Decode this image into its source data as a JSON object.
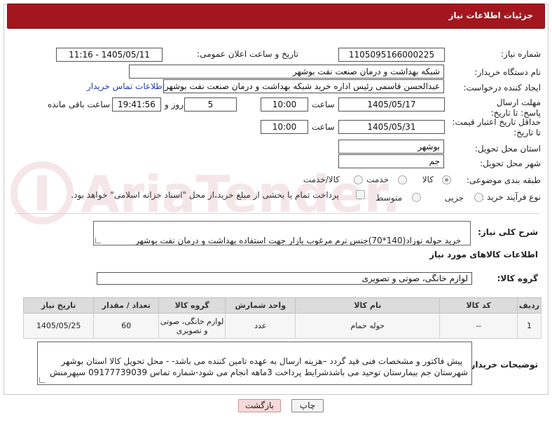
{
  "header": {
    "title": "جزئیات اطلاعات نیاز"
  },
  "fields": {
    "need_number_label": "شماره نیاز:",
    "need_number": "1105095166000225",
    "announce_label": "تاریخ و ساعت اعلان عمومی:",
    "announce_value": "1405/05/11 - 11:16",
    "buyer_org_label": "نام دستگاه خریدار:",
    "buyer_org": "شبکه بهداشت و درمان صنعت نفت بوشهر",
    "requester_label": "ایجاد کننده درخواست:",
    "requester": "عبدالحسن قاسمی رئیس اداره خرید  شبکه بهداشت و درمان صنعت نفت بوشهر",
    "buyer_contact_link": "اطلاعات تماس خریدار",
    "deadline_label": "مهلت ارسال پاسخ: تا تاریخ:",
    "deadline_date": "1405/05/17",
    "time_label": "ساعت",
    "deadline_time": "10:00",
    "days_value": "5",
    "days_label": "روز و",
    "remaining_time": "19:41:56",
    "remaining_label": "ساعت باقی مانده",
    "validity_label": "حداقل تاریخ اعتبار قیمت: تا تاریخ:",
    "validity_date": "1405/05/31",
    "validity_time_label": "ساعت",
    "validity_time": "10:00",
    "province_label": "استان محل تحویل:",
    "province": "بوشهر",
    "city_label": "شهر محل تحویل:",
    "city": "جم",
    "category_label": "طبقه بندی موضوعی:",
    "category_options": [
      "کالا",
      "خدمت",
      "کالا/خدمت"
    ],
    "process_label": "نوع فرآیند خرید :",
    "process_options": [
      "جزیی",
      "متوسط"
    ],
    "payment_note": "پرداخت تمام یا بخشی از مبلغ خرید،از محل \"اسناد خزانه اسلامی\" خواهد بود."
  },
  "description": {
    "label": "شرح کلی نیاز:",
    "text": "خرید حوله نوزاد(140*70)جنس نرم مرغوب بازار جهت استفاده بهداشت و درمان نفت بوشهر"
  },
  "goods_info": {
    "title": "اطلاعات کالاهای مورد نیاز"
  },
  "goods_group": {
    "label": "گروه کالا:",
    "value": "لوازم خانگی، صوتی و تصویری"
  },
  "table": {
    "headers": [
      "ردیف",
      "کد کالا",
      "نام کالا",
      "واحد شمارش",
      "گروه کالا",
      "تعداد / مقدار",
      "تاریخ نیاز"
    ],
    "rows": [
      [
        "1",
        "--",
        "حوله حمام",
        "عدد",
        "لوازم خانگی، صوتی و تصویری",
        "60",
        "1405/05/25"
      ]
    ]
  },
  "buyer_notes": {
    "label": "توضیحات خریدار:",
    "text": "پیش فاکتور و مشخصات فنی قید گردد –هزینه ارسال به عهده تامین کننده می باشد- - محل تحویل کالا استان بوشهر شهرستان جم بیمارستان توحید می باشدشرایط پرداخت 3ماهه انجام می شود-شماره تماس 09177739039 سپهرمنش"
  },
  "buttons": {
    "print": "چاپ",
    "back": "بازگشت"
  },
  "watermark": {
    "text": "AriaTender.net"
  },
  "colors": {
    "header": "#a3161e",
    "link": "#1f3fa8",
    "back_button": "#f7d9d9"
  }
}
